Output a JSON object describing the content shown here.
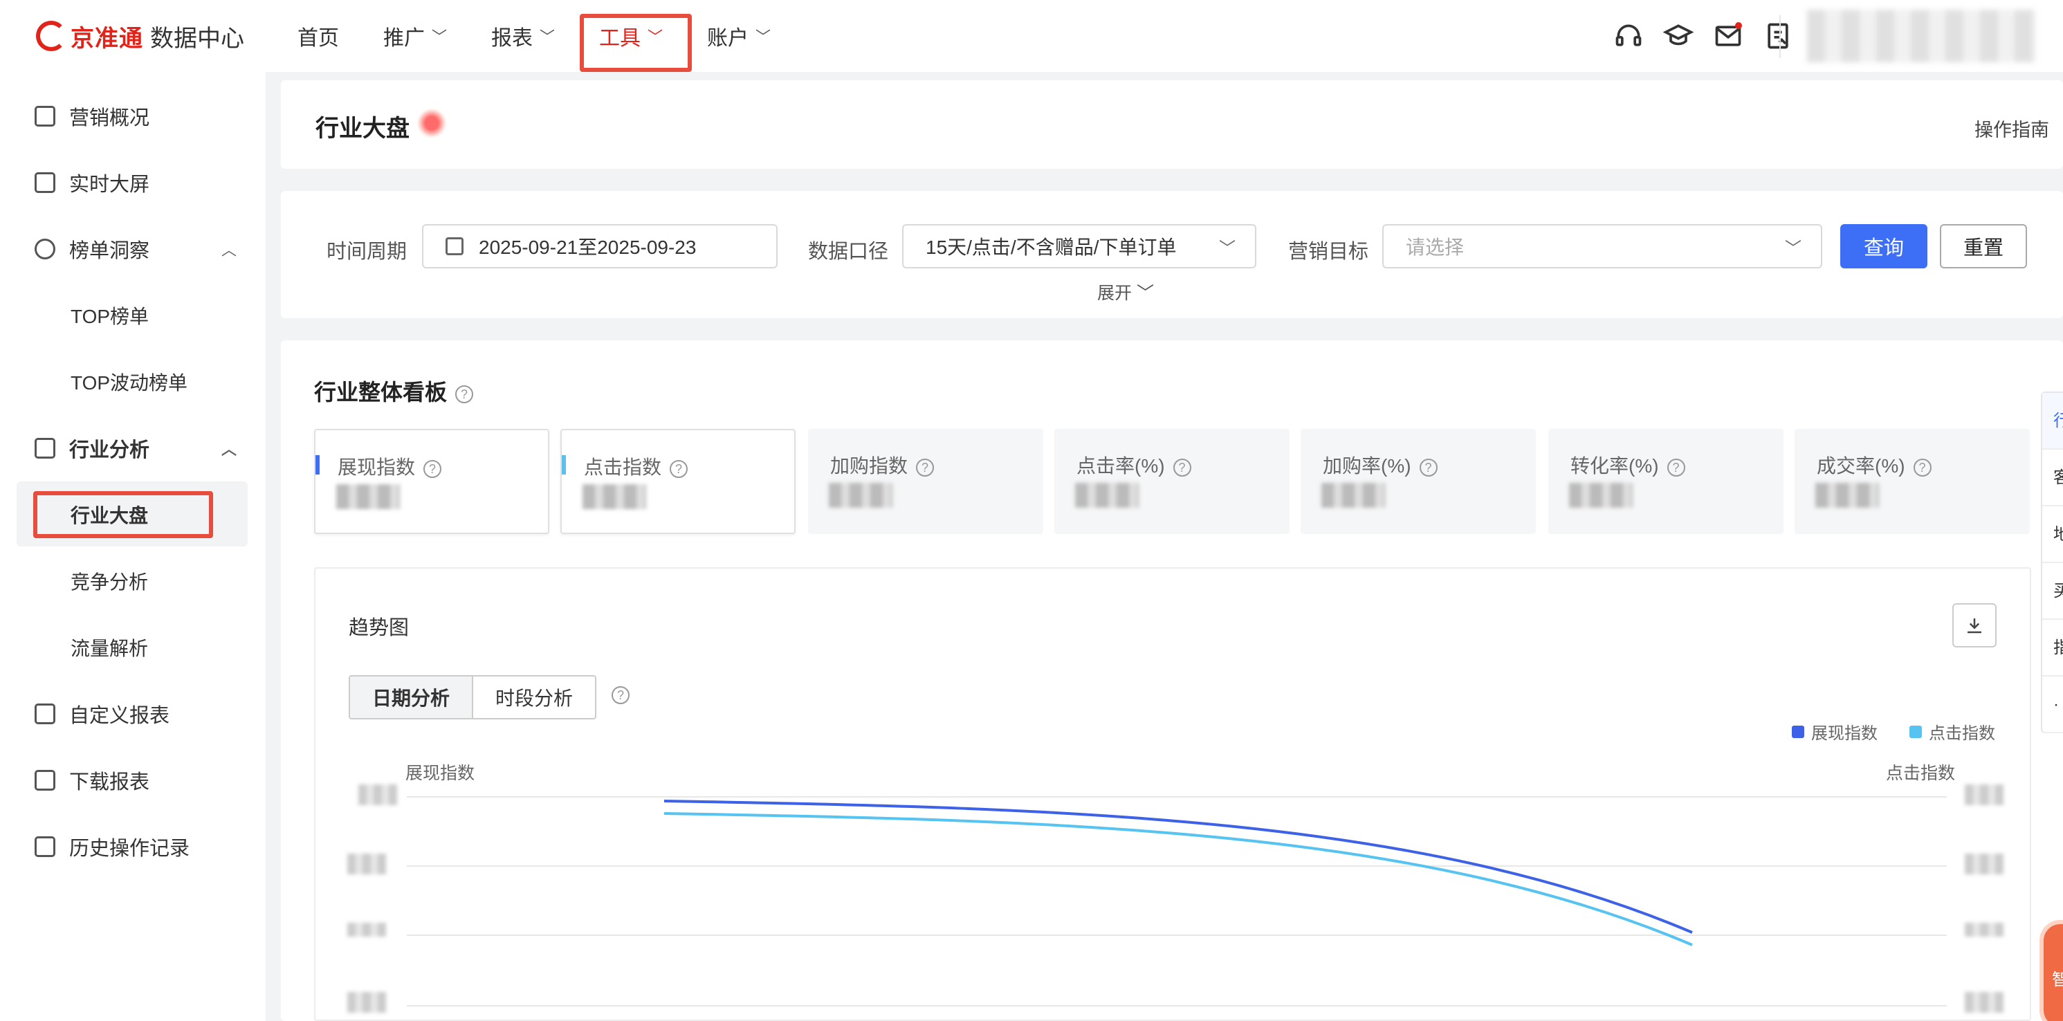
{
  "brand": {
    "name": "京准通",
    "sub": "数据中心"
  },
  "nav": {
    "items": [
      {
        "label": "首页",
        "chevron": false
      },
      {
        "label": "推广",
        "chevron": true
      },
      {
        "label": "报表",
        "chevron": true
      },
      {
        "label": "工具",
        "chevron": true
      },
      {
        "label": "账户",
        "chevron": true
      }
    ]
  },
  "top_icons": [
    "headset-icon",
    "graduation-cap-icon",
    "mail-icon",
    "clipboard-icon"
  ],
  "sidebar": {
    "items": [
      {
        "label": "营销概况"
      },
      {
        "label": "实时大屏"
      },
      {
        "label": "榜单洞察"
      },
      {
        "label": "TOP榜单"
      },
      {
        "label": "TOP波动榜单"
      },
      {
        "label": "行业分析"
      },
      {
        "label": "行业大盘"
      },
      {
        "label": "竞争分析"
      },
      {
        "label": "流量解析"
      },
      {
        "label": "自定义报表"
      },
      {
        "label": "下载报表"
      },
      {
        "label": "历史操作记录"
      }
    ]
  },
  "page": {
    "title": "行业大盘",
    "guide": "操作指南"
  },
  "filters": {
    "period_label": "时间周期",
    "period_value": "2025-09-21至2025-09-23",
    "scope_label": "数据口径",
    "scope_value": "15天/点击/不含赠品/下单订单",
    "goal_label": "营销目标",
    "goal_placeholder": "请选择",
    "query": "查询",
    "reset": "重置",
    "expand": "展开"
  },
  "board": {
    "title": "行业整体看板",
    "metrics": [
      {
        "label": "展现指数",
        "color": "#3d6ef6"
      },
      {
        "label": "点击指数",
        "color": "#5bc0eb"
      },
      {
        "label": "加购指数"
      },
      {
        "label": "点击率(%)"
      },
      {
        "label": "加购率(%)"
      },
      {
        "label": "转化率(%)"
      },
      {
        "label": "成交率(%)"
      }
    ]
  },
  "trend": {
    "title": "趋势图",
    "tabs": [
      "日期分析",
      "时段分析"
    ],
    "legend": [
      {
        "name": "展现指数",
        "color": "#3d62e8"
      },
      {
        "name": "点击指数",
        "color": "#56c3f0"
      }
    ],
    "y_left_label": "展现指数",
    "y_right_label": "点击指数"
  },
  "right_tabs": [
    "行",
    "客",
    "地",
    "买",
    "指",
    "·"
  ],
  "float_badge": "智"
}
